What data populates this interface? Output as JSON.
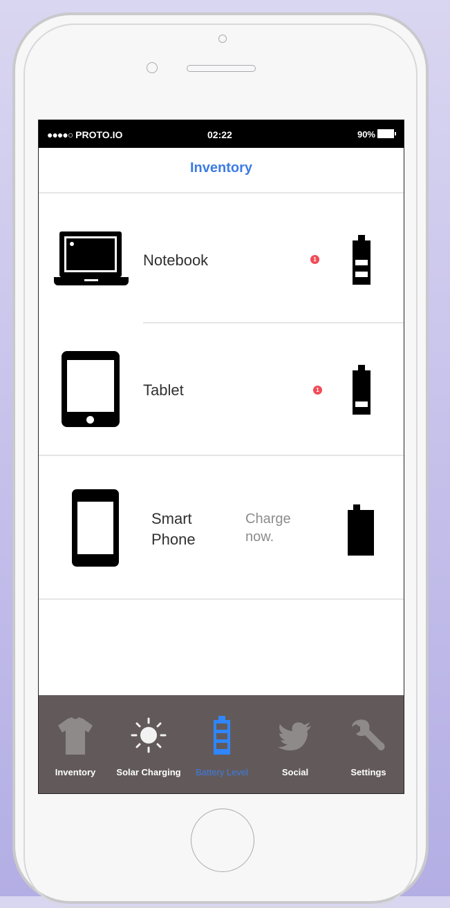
{
  "status_bar": {
    "carrier": "PROTO.IO",
    "signal_dots": "●●●●○",
    "time": "02:22",
    "battery_percent": "90%"
  },
  "header": {
    "title": "Inventory"
  },
  "devices": [
    {
      "name": "Notebook",
      "badge": "1",
      "battery_level": "medium"
    },
    {
      "name": "Tablet",
      "badge": "1",
      "battery_level": "low"
    },
    {
      "name_line1": "Smart",
      "name_line2": "Phone",
      "note_line1": "Charge",
      "note_line2": "now.",
      "battery_level": "empty"
    }
  ],
  "tabs": [
    {
      "label": "Inventory",
      "icon": "tshirt-icon",
      "active": false
    },
    {
      "label": "Solar Charging",
      "icon": "sun-icon",
      "active": false
    },
    {
      "label": "Battery Level",
      "icon": "battery-icon",
      "active": true
    },
    {
      "label": "Social",
      "icon": "bird-icon",
      "active": false
    },
    {
      "label": "Settings",
      "icon": "wrench-icon",
      "active": false
    }
  ],
  "colors": {
    "accent": "#3d7be4",
    "badge": "#f24c58",
    "tabbar": "#625a5a",
    "background": "#c8c3eb"
  }
}
